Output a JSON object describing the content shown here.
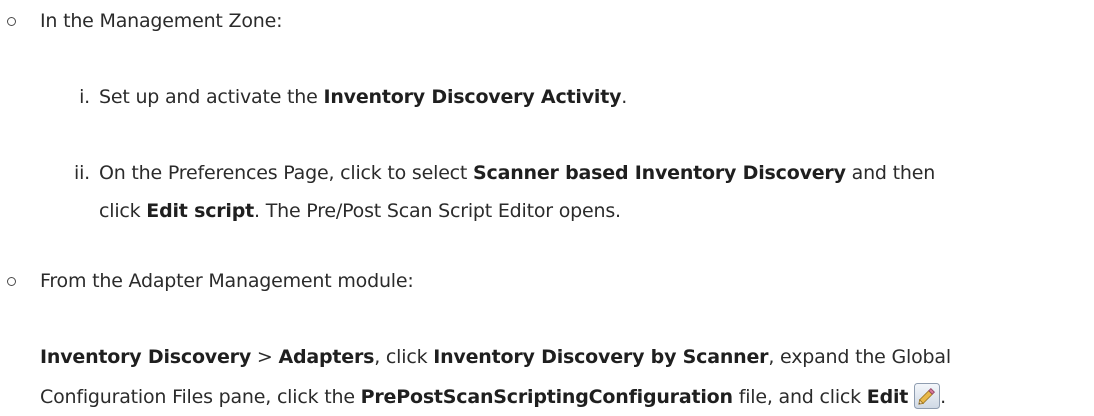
{
  "bullet1": {
    "text": "In the Management Zone:"
  },
  "step_i": {
    "marker": "i.",
    "before": "Set up and activate the ",
    "bold1": "Inventory Discovery Activity",
    "after": "."
  },
  "step_ii": {
    "marker": "ii.",
    "before": "On the Preferences Page, click to select ",
    "bold1": "Scanner based Inventory Discovery",
    "mid": " and then",
    "cont_before": "click ",
    "bold2": "Edit script",
    "after": ". The Pre/Post Scan Script Editor opens."
  },
  "bullet2": {
    "text": "From the Adapter Management module:"
  },
  "para": {
    "b1": "Inventory Discovery",
    "t1": " > ",
    "b2": "Adapters",
    "t2": ", click ",
    "b3": "Inventory Discovery by Scanner",
    "t3": ", expand the Global",
    "t4": "Configuration Files pane, click the ",
    "b4": "PrePostScanScriptingConfiguration",
    "t5": " file, and click ",
    "b5": "Edit",
    "t6": "."
  },
  "icons": {
    "edit": "pencil-edit-icon"
  }
}
